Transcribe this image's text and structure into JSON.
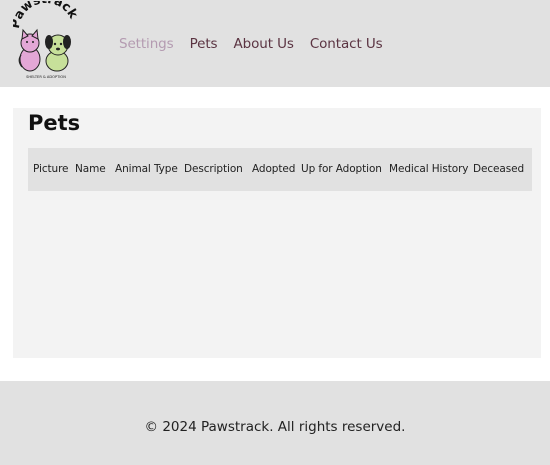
{
  "logo": {
    "text": "Pawstrack",
    "subtext": "SHELTER & ADOPTION"
  },
  "nav": {
    "settings": "Settings",
    "pets": "Pets",
    "about": "About Us",
    "contact": "Contact Us"
  },
  "main": {
    "title": "Pets",
    "columns": [
      "Picture",
      "Name",
      "Animal Type",
      "Description",
      "Adopted",
      "Up for Adoption",
      "Medical History",
      "Deceased"
    ]
  },
  "footer": {
    "text": "© 2024 Pawstrack. All rights reserved."
  },
  "colors": {
    "header_bg": "#e1e1e1",
    "nav_text": "#5b3442",
    "nav_active": "#b49bb1",
    "panel_bg": "#f3f3f3"
  }
}
